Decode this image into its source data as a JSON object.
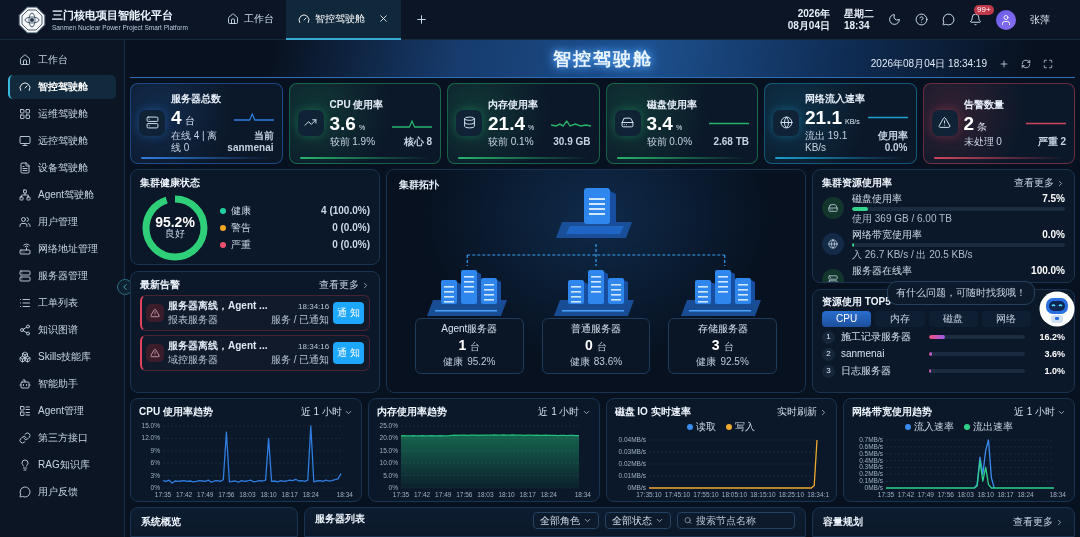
{
  "header": {
    "title": "三门核电项目智能化平台",
    "subtitle": "Sanmen Nuclear Power Project Smart Platform",
    "date_year": "2026年",
    "date_day": "08月04日",
    "weekday": "星期二",
    "time": "18:34",
    "badge": "99+",
    "user": "张萍",
    "tabs": [
      {
        "label": "工作台",
        "selected": false
      },
      {
        "label": "智控驾驶舱",
        "selected": true
      }
    ]
  },
  "sidebar": {
    "items": [
      {
        "label": "工作台",
        "selected": false
      },
      {
        "label": "智控驾驶舱",
        "selected": true
      },
      {
        "label": "运维驾驶舱",
        "selected": false
      },
      {
        "label": "远控驾驶舱",
        "selected": false
      },
      {
        "label": "设备驾驶舱",
        "selected": false
      },
      {
        "label": "Agent驾驶舱",
        "selected": false
      },
      {
        "label": "用户管理",
        "selected": false
      },
      {
        "label": "网络地址管理",
        "selected": false
      },
      {
        "label": "服务器管理",
        "selected": false
      },
      {
        "label": "工单列表",
        "selected": false
      },
      {
        "label": "知识图谱",
        "selected": false
      },
      {
        "label": "Skills技能库",
        "selected": false
      },
      {
        "label": "智能助手",
        "selected": false
      },
      {
        "label": "Agent管理",
        "selected": false
      },
      {
        "label": "第三方接口",
        "selected": false
      },
      {
        "label": "RAG知识库",
        "selected": false
      },
      {
        "label": "用户反馈",
        "selected": false
      }
    ]
  },
  "banner": {
    "title": "智控驾驶舱",
    "timestamp": "2026年08月04日 18:34:19"
  },
  "stat_cards": [
    {
      "title": "服务器总数",
      "value": "4",
      "unit": "台",
      "sub_left": "在线 4 | 离线 0",
      "sub_right": "当前 sanmenai",
      "color": "#2f7de1"
    },
    {
      "title": "CPU 使用率",
      "value": "3.6",
      "unit": "%",
      "sub_left": "较前 1.9%",
      "sub_right": "核心 8",
      "color": "#27b56a"
    },
    {
      "title": "内存使用率",
      "value": "21.4",
      "unit": "%",
      "sub_left": "较前 0.1%",
      "sub_right": "30.9 GB",
      "color": "#27b56a"
    },
    {
      "title": "磁盘使用率",
      "value": "3.4",
      "unit": "%",
      "sub_left": "较前 0.0%",
      "sub_right": "2.68 TB",
      "color": "#27b56a"
    },
    {
      "title": "网络流入速率",
      "value": "21.1",
      "unit": "KB/s",
      "sub_left": "流出 19.1 KB/s",
      "sub_right": "使用率 0.0%",
      "color": "#1a9fd0"
    },
    {
      "title": "告警数量",
      "value": "2",
      "unit": "条",
      "sub_left": "未处理 0",
      "sub_right": "严重 2",
      "color": "#d0455a"
    }
  ],
  "cluster_health": {
    "title": "集群健康状态",
    "score": "95.2%",
    "level": 0.952,
    "status": "良好",
    "legend": [
      {
        "label": "健康",
        "value": "4 (100.0%)",
        "color": "#1fd1a0"
      },
      {
        "label": "警告",
        "value": "0 (0.0%)",
        "color": "#f5a524"
      },
      {
        "label": "严重",
        "value": "0 (0.0%)",
        "color": "#f0506e"
      }
    ]
  },
  "alerts": {
    "title": "最新告警",
    "more": "查看更多",
    "items": [
      {
        "message": "服务器离线，Agent ...",
        "time": "18:34:16",
        "source": "报表服务器",
        "status": "服务 / 已通知",
        "action": "通 知"
      },
      {
        "message": "服务器离线，Agent ...",
        "time": "18:34:16",
        "source": "域控服务器",
        "status": "服务 / 已通知",
        "action": "通 知"
      }
    ]
  },
  "topology": {
    "title": "集群拓扑",
    "nodes": [
      {
        "name": "Agent服务器",
        "count": "1",
        "unit": "台",
        "health_label": "健康",
        "health": "95.2%"
      },
      {
        "name": "普通服务器",
        "count": "0",
        "unit": "台",
        "health_label": "健康",
        "health": "83.6%"
      },
      {
        "name": "存储服务器",
        "count": "3",
        "unit": "台",
        "health_label": "健康",
        "health": "92.5%"
      }
    ]
  },
  "resources": {
    "title": "集群资源使用率",
    "more": "查看更多",
    "items": [
      {
        "label": "磁盘使用率",
        "value": "7.5%",
        "level": 0.075,
        "detail": "使用 369 GB / 6.00 TB"
      },
      {
        "label": "网络带宽使用率",
        "value": "0.0%",
        "level": 0,
        "detail": "入 26.7 KB/s / 出 20.5 KB/s"
      },
      {
        "label": "服务器在线率",
        "value": "100.0%"
      }
    ]
  },
  "top5": {
    "title": "资源使用 TOP5",
    "tabs": [
      {
        "label": "CPU",
        "selected": true
      },
      {
        "label": "内存",
        "selected": false
      },
      {
        "label": "磁盘",
        "selected": false
      },
      {
        "label": "网络",
        "selected": false
      }
    ],
    "rows": [
      {
        "rank": "1",
        "name": "施工记录服务器",
        "value": "16.2%",
        "level": 0.162
      },
      {
        "rank": "2",
        "name": "sanmenai",
        "value": "3.6%",
        "level": 0.036
      },
      {
        "rank": "3",
        "name": "日志服务器",
        "value": "1.0%",
        "level": 0.01
      }
    ]
  },
  "assistant": {
    "message": "有什么问题，可随时找我哦！"
  },
  "charts": [
    {
      "title": "CPU 使用率趋势",
      "control": "近 1 小时",
      "kind": "dropdown",
      "chart_data": {
        "type": "line",
        "grid": true,
        "ylim": [
          0,
          15
        ],
        "categories": [
          "17:35",
          null,
          null,
          null,
          null,
          null,
          null,
          "17:42",
          null,
          null,
          null,
          null,
          null,
          null,
          "17:49",
          null,
          null,
          null,
          null,
          null,
          null,
          "17:56",
          null,
          null,
          null,
          null,
          null,
          null,
          "18:03",
          null,
          null,
          null,
          null,
          null,
          null,
          "18:10",
          null,
          null,
          null,
          null,
          null,
          null,
          "18:17",
          null,
          null,
          null,
          null,
          null,
          null,
          "18:24",
          null,
          null,
          null,
          null,
          null,
          null,
          null,
          null,
          null,
          "18:34"
        ],
        "yticks": [
          {
            "value": 0,
            "label": "0%"
          },
          {
            "value": 3,
            "label": "3%"
          },
          {
            "value": 6,
            "label": "6%"
          },
          {
            "value": 9,
            "label": "9%"
          },
          {
            "value": 12,
            "label": "12.0%"
          },
          {
            "value": 15,
            "label": "15.0%"
          }
        ],
        "series": [
          {
            "color": "#2f7de1",
            "values": [
              1.8,
              1.6,
              1.9,
              1.2,
              1.7,
              1.6,
              1.7,
              1.8,
              1.6,
              1.7,
              1.5,
              1.6,
              1.8,
              1.7,
              1.6,
              1.9,
              1.4,
              1.7,
              1.8,
              1.6,
              2.0,
              13.5,
              1.5,
              1.6,
              1.7,
              1.4,
              1.8,
              1.6,
              1.7,
              1.9,
              1.5,
              1.6,
              1.8,
              1.7,
              1.9,
              12.0,
              1.6,
              1.7,
              1.5,
              1.8,
              1.6,
              1.7,
              1.9,
              1.8,
              2.1,
              1.7,
              1.8,
              1.6,
              1.9,
              15.0,
              1.5,
              1.7,
              1.8,
              1.6,
              1.9,
              1.7,
              1.8,
              2.0,
              2.2,
              3.5
            ]
          }
        ]
      }
    },
    {
      "title": "内存使用率趋势",
      "control": "近 1 小时",
      "kind": "dropdown",
      "chart_data": {
        "type": "area",
        "grid": true,
        "ylim": [
          0,
          25
        ],
        "categories": [
          "17:35",
          null,
          null,
          null,
          null,
          null,
          null,
          "17:42",
          null,
          null,
          null,
          null,
          null,
          null,
          "17:49",
          null,
          null,
          null,
          null,
          null,
          null,
          "17:56",
          null,
          null,
          null,
          null,
          null,
          null,
          "18:03",
          null,
          null,
          null,
          null,
          null,
          null,
          "18:10",
          null,
          null,
          null,
          null,
          null,
          null,
          "18:17",
          null,
          null,
          null,
          null,
          null,
          null,
          "18:24",
          null,
          null,
          null,
          null,
          null,
          null,
          null,
          null,
          null,
          "18:34"
        ],
        "yticks": [
          {
            "value": 0,
            "label": "0%"
          },
          {
            "value": 5,
            "label": "5.0%"
          },
          {
            "value": 10,
            "label": "10.0%"
          },
          {
            "value": 15,
            "label": "15.0%"
          },
          {
            "value": 20,
            "label": "20.0%"
          },
          {
            "value": 25,
            "label": "25.0%"
          }
        ],
        "series": [
          {
            "color": "#22c07a",
            "values": [
              21,
              21.1,
              21,
              21,
              21.1,
              21,
              21,
              21.1,
              21,
              21,
              21.1,
              21,
              21,
              21.1,
              21,
              21,
              21.1,
              21.2,
              21.3,
              21.2,
              21.3,
              21.3,
              21.2,
              21.3,
              21.3,
              21.3,
              21.2,
              21.3,
              21.3,
              21.3,
              21.3,
              21.4,
              21.3,
              21.3,
              21.4,
              21.3,
              21.3,
              21.4,
              21.3,
              21.3,
              21.3,
              21.2,
              21.3,
              21.3,
              21.2,
              21.3,
              21.2,
              21.2,
              21.3,
              21.2,
              21.2,
              21.2,
              21.1,
              21.2,
              21.2,
              21.1,
              21.2,
              21.2,
              21.1,
              21.1
            ]
          }
        ]
      }
    },
    {
      "title": "磁盘 IO 实时速率",
      "control": "实时刷新",
      "kind": "link",
      "chart_data": {
        "type": "line",
        "grid": true,
        "ylim": [
          0,
          0.04
        ],
        "categories": [
          "17:35:10",
          null,
          null,
          null,
          null,
          null,
          null,
          null,
          null,
          null,
          "17:45:10",
          null,
          null,
          null,
          null,
          null,
          null,
          null,
          null,
          null,
          "17:55:10",
          null,
          null,
          null,
          null,
          null,
          null,
          null,
          null,
          null,
          "18:05:10",
          null,
          null,
          null,
          null,
          null,
          null,
          null,
          null,
          null,
          "18:15:10",
          null,
          null,
          null,
          null,
          null,
          null,
          null,
          null,
          null,
          "18:25:10",
          null,
          null,
          null,
          null,
          null,
          null,
          null,
          null,
          "18:34:1"
        ],
        "yticks": [
          {
            "value": 0,
            "label": "0MB/s"
          },
          {
            "value": 0.01,
            "label": "0.01MB/s"
          },
          {
            "value": 0.02,
            "label": "0.02MB/s"
          },
          {
            "value": 0.03,
            "label": "0.03MB/s"
          },
          {
            "value": 0.04,
            "label": "0.04MB/s"
          }
        ],
        "series": [
          {
            "name": "读取",
            "color": "#3b8cf0",
            "values": [
              null,
              null,
              null,
              null,
              null,
              null,
              null,
              null,
              null,
              null,
              null,
              null,
              null,
              null,
              null,
              null,
              null,
              null,
              null,
              null,
              null,
              null,
              null,
              null,
              null,
              null,
              null,
              null,
              null,
              null,
              null,
              null,
              null,
              null,
              null,
              null,
              null,
              null,
              null,
              null,
              null,
              null,
              null,
              null,
              null,
              null,
              null,
              null,
              null,
              null,
              null,
              null,
              null,
              null,
              null,
              null,
              null,
              null,
              null,
              null
            ]
          },
          {
            "name": "写入",
            "color": "#f0a830",
            "values": [
              0,
              0,
              0,
              0,
              0,
              0,
              0,
              0,
              0,
              0,
              0,
              0,
              0,
              0,
              0,
              0,
              0,
              0,
              0,
              0,
              0,
              0,
              0,
              0,
              0,
              0,
              0,
              0,
              0,
              0,
              0,
              0,
              0,
              0,
              0,
              0,
              0,
              0,
              0,
              0,
              0,
              0,
              0,
              0,
              0,
              0,
              0,
              0,
              0,
              0,
              0,
              0,
              0,
              0,
              0,
              0,
              0,
              0,
              0.002,
              0.04
            ]
          }
        ]
      }
    },
    {
      "title": "网络带宽使用趋势",
      "control": "近 1 小时",
      "kind": "dropdown",
      "chart_data": {
        "type": "line",
        "grid": true,
        "ylim": [
          0,
          0.7
        ],
        "categories": [
          "17:35",
          null,
          null,
          null,
          null,
          null,
          null,
          "17:42",
          null,
          null,
          null,
          null,
          null,
          null,
          "17:49",
          null,
          null,
          null,
          null,
          null,
          null,
          "17:56",
          null,
          null,
          null,
          null,
          null,
          null,
          "18:03",
          null,
          null,
          null,
          null,
          null,
          null,
          "18:10",
          null,
          null,
          null,
          null,
          null,
          null,
          "18:17",
          null,
          null,
          null,
          null,
          null,
          null,
          "18:24",
          null,
          null,
          null,
          null,
          null,
          null,
          null,
          null,
          null,
          "18:34"
        ],
        "yticks": [
          {
            "value": 0,
            "label": "0MB/s"
          },
          {
            "value": 0.1,
            "label": "0.1MB/s"
          },
          {
            "value": 0.2,
            "label": "0.2MB/s"
          },
          {
            "value": 0.3,
            "label": "0.3MB/s"
          },
          {
            "value": 0.4,
            "label": "0.4MB/s"
          },
          {
            "value": 0.5,
            "label": "0.5MB/s"
          },
          {
            "value": 0.6,
            "label": "0.6MB/s"
          },
          {
            "value": 0.7,
            "label": "0.7MB/s"
          }
        ],
        "series": [
          {
            "name": "流入速率",
            "color": "#3b8cf0",
            "values": [
              null,
              null,
              null,
              null,
              null,
              null,
              null,
              null,
              null,
              null,
              null,
              null,
              null,
              null,
              null,
              null,
              null,
              null,
              null,
              null,
              null,
              null,
              null,
              null,
              null,
              null,
              null,
              null,
              null,
              null,
              null,
              0,
              0.05,
              0.45,
              0.2,
              0.55,
              0.7,
              0.15,
              0,
              null,
              null,
              null,
              null,
              null,
              null,
              null,
              null,
              null,
              null,
              null,
              null,
              null,
              null,
              null,
              null,
              null,
              null,
              null,
              null,
              null
            ]
          },
          {
            "name": "流出速率",
            "color": "#2fd08a",
            "values": [
              0,
              0,
              0,
              0,
              0,
              0,
              0,
              0,
              0,
              0,
              0,
              0,
              0,
              0,
              0,
              0,
              0,
              0,
              0,
              0,
              0,
              0,
              0,
              0,
              0,
              0,
              0,
              0,
              0,
              0,
              0,
              0,
              0.03,
              0.4,
              0.1,
              0.3,
              0.05,
              0,
              0,
              0,
              0,
              0,
              0,
              0,
              0,
              0,
              0,
              0,
              0,
              0,
              0,
              0,
              0,
              0,
              0,
              0,
              0,
              0,
              0,
              0
            ]
          }
        ]
      }
    }
  ],
  "bottom": {
    "overview": {
      "title": "系统概览"
    },
    "server_list": {
      "title": "服务器列表",
      "filters": [
        "全部角色",
        "全部状态"
      ],
      "search_placeholder": "搜索节点名称"
    },
    "capacity": {
      "title": "容量规划",
      "more": "查看更多"
    }
  }
}
